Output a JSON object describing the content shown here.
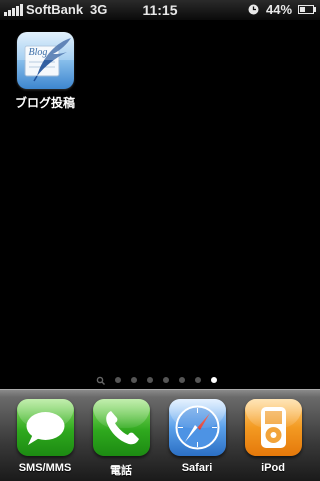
{
  "status_bar": {
    "carrier": "SoftBank",
    "network": "3G",
    "time": "11:15",
    "battery_percent": "44%",
    "battery_level": 0.44,
    "signal_bars": 5,
    "icons": [
      "signal-icon",
      "clock-icon",
      "battery-icon"
    ]
  },
  "home": {
    "apps": [
      {
        "label": "ブログ投稿",
        "icon": "blog-quill-icon",
        "icon_text": "Blog"
      }
    ],
    "page_dots": {
      "count": 7,
      "active_index": 6,
      "has_search_dot": true
    }
  },
  "dock": {
    "apps": [
      {
        "label": "SMS/MMS",
        "icon": "speech-bubble-icon",
        "color": "#3fbf2a"
      },
      {
        "label": "電話",
        "icon": "phone-handset-icon",
        "color": "#3fbf2a"
      },
      {
        "label": "Safari",
        "icon": "compass-icon",
        "color": "#3a7fd6"
      },
      {
        "label": "iPod",
        "icon": "ipod-icon",
        "color": "#f08a1c"
      }
    ]
  }
}
